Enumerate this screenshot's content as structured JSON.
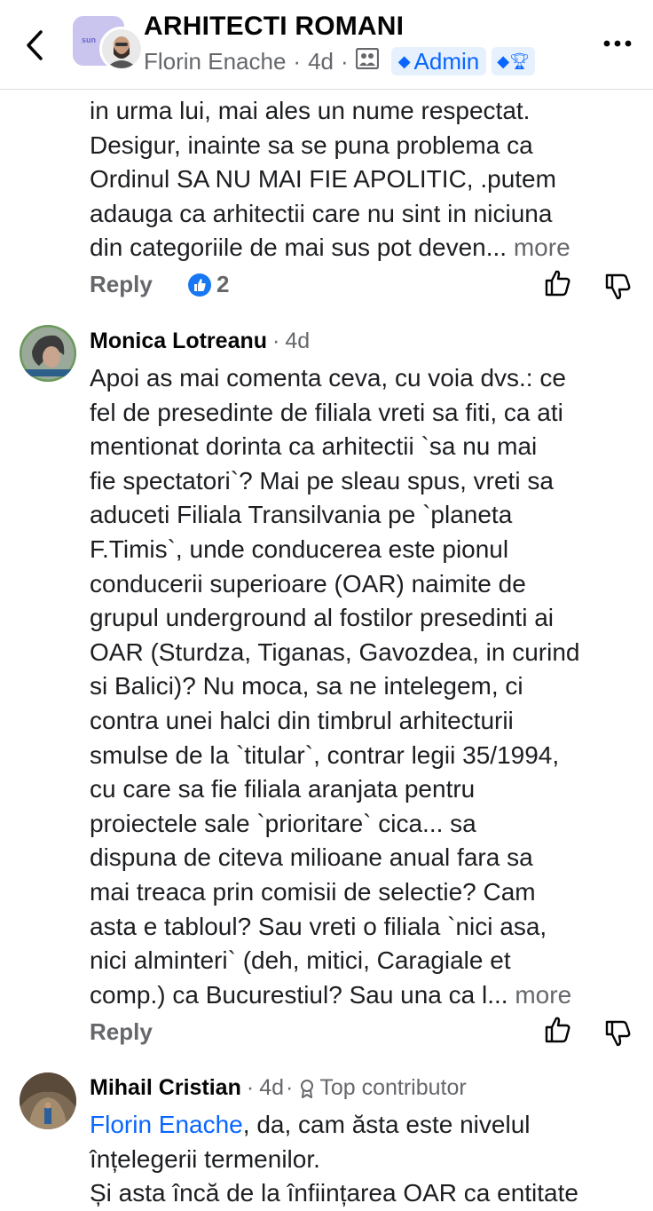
{
  "header": {
    "group_name": "ARHITECTI ROMANI",
    "tile_text": "sun",
    "author": "Florin Enache",
    "time": "4d",
    "admin_label": "Admin"
  },
  "comments": [
    {
      "text_lines": [
        "in urma lui, mai ales un nume respectat.",
        "Desigur, inainte sa se puna problema ca",
        "Ordinul SA NU MAI FIE APOLITIC, .putem",
        "adauga ca arhitectii care nu sint in niciuna",
        "din categoriile de mai sus pot deven..."
      ],
      "more_label": "more",
      "reply_label": "Reply",
      "like_count": "2"
    },
    {
      "author": "Monica Lotreanu",
      "time": "4d",
      "text_lines": [
        "Apoi as mai comenta ceva, cu voia dvs.: ce",
        "fel de presedinte de filiala vreti sa fiti, ca ati",
        "mentionat dorinta ca arhitectii `sa nu mai",
        "fie spectatori`? Mai pe sleau spus, vreti sa",
        "aduceti Filiala Transilvania pe `planeta",
        "F.Timis`, unde conducerea este pionul",
        "conducerii superioare (OAR) naimite de",
        "grupul underground al fostilor presedinti ai",
        "OAR (Sturdza, Tiganas, Gavozdea, in curind",
        "si Balici)? Nu moca, sa ne intelegem, ci",
        "contra unei halci din timbrul arhitecturii",
        "smulse de la `titular`, contrar legii 35/1994,",
        "cu care sa fie filiala aranjata pentru",
        "proiectele sale `prioritare` cica... sa",
        "dispuna de citeva milioane anual fara sa",
        "mai treaca prin comisii de selectie? Cam",
        "asta e tabloul? Sau vreti o filiala `nici asa,",
        "nici alminteri` (deh, mitici, Caragiale et",
        "comp.) ca Bucurestiul? Sau una ca l..."
      ],
      "more_label": "more",
      "reply_label": "Reply"
    },
    {
      "author": "Mihail Cristian",
      "time": "4d",
      "badge": "Top contributor",
      "mention": "Florin Enache",
      "first_line_rest": ", da, cam ăsta este nivelul",
      "text_lines": [
        "înțelegerii termenilor.",
        "Și asta încă de la înființarea OAR ca entitate"
      ]
    }
  ]
}
